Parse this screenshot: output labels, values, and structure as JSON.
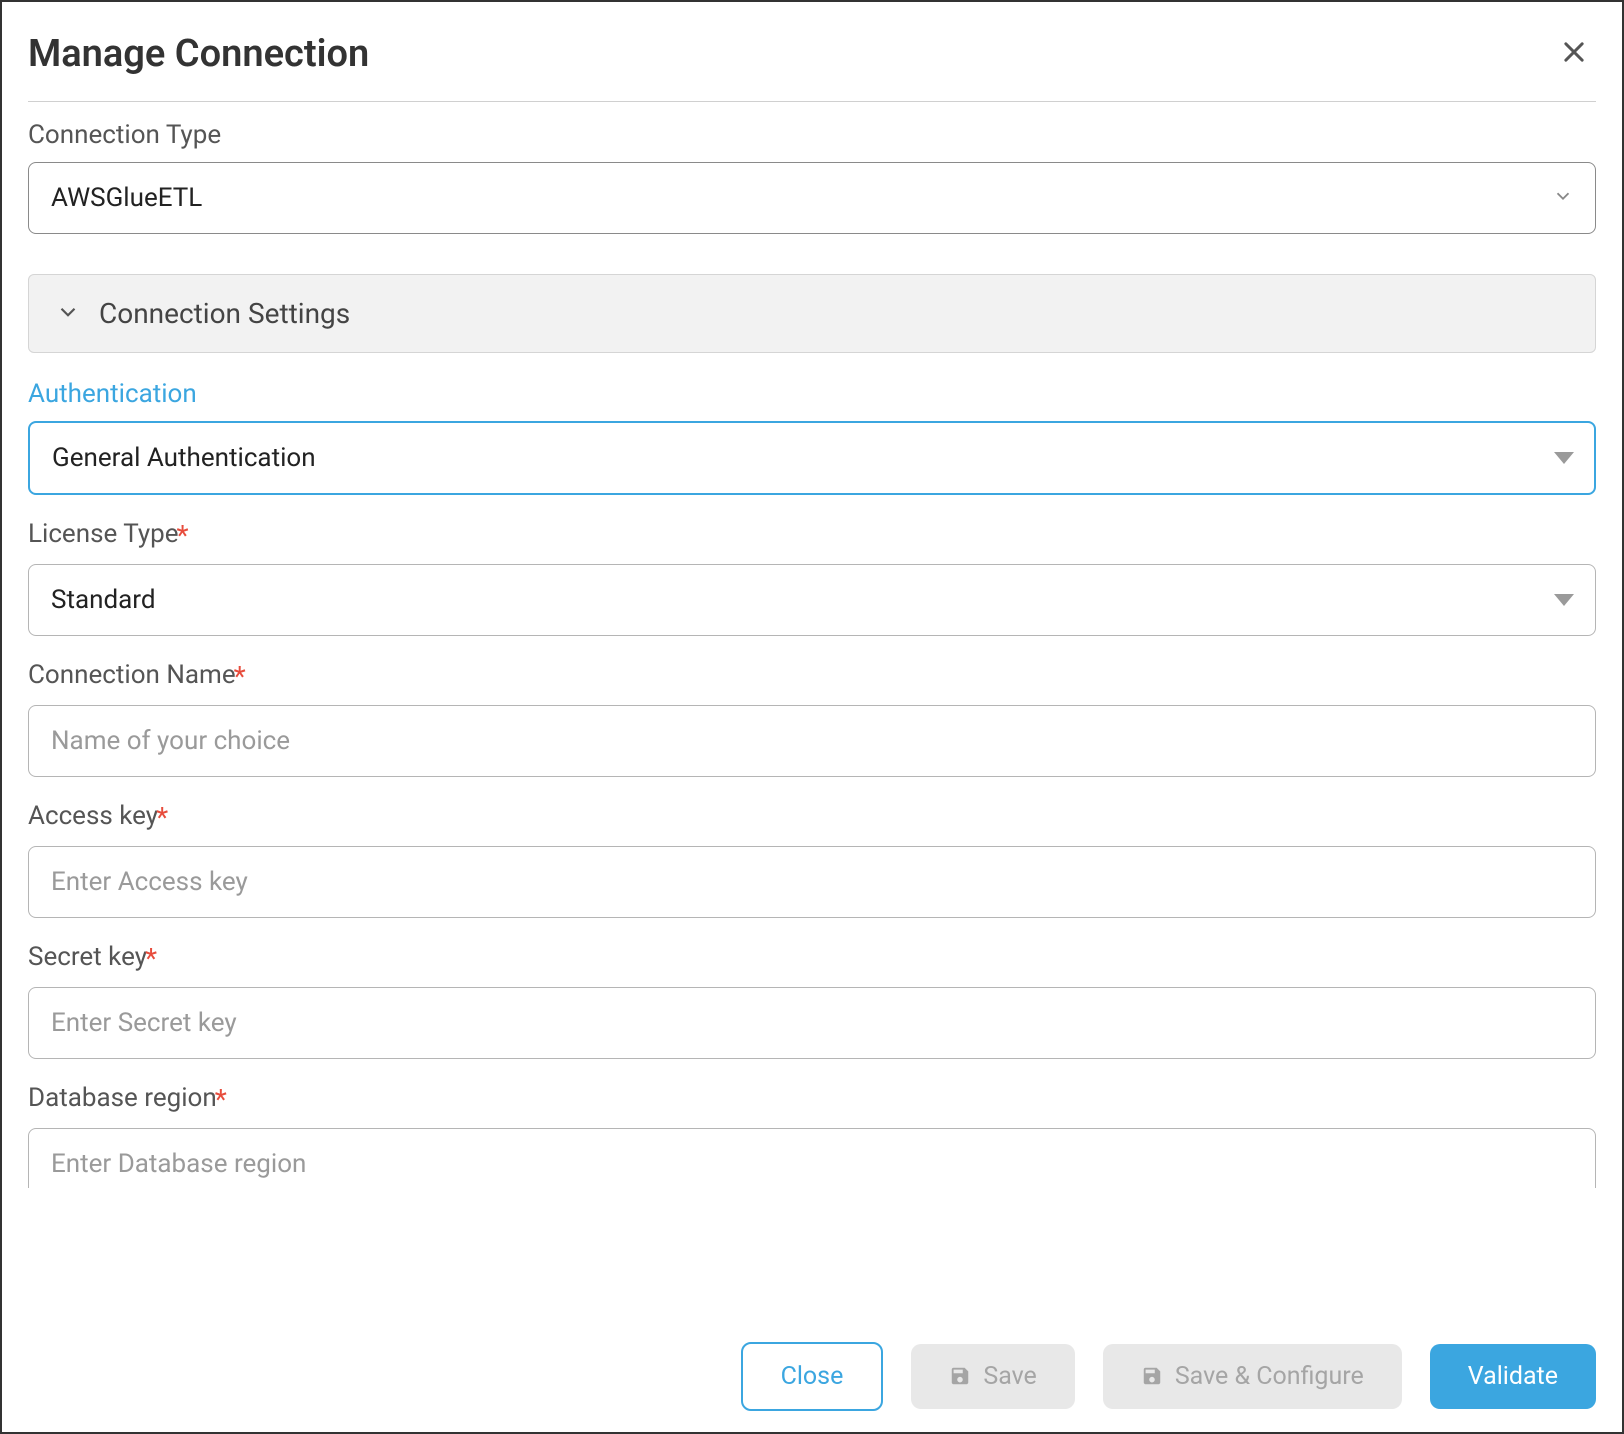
{
  "modal": {
    "title": "Manage Connection"
  },
  "fields": {
    "connectionType": {
      "label": "Connection Type",
      "value": "AWSGlueETL"
    },
    "connectionSettings": {
      "title": "Connection Settings"
    },
    "authentication": {
      "label": "Authentication",
      "value": "General Authentication"
    },
    "licenseType": {
      "label": "License Type",
      "value": "Standard"
    },
    "connectionName": {
      "label": "Connection Name",
      "placeholder": "Name of your choice",
      "value": ""
    },
    "accessKey": {
      "label": "Access key",
      "placeholder": "Enter Access key",
      "value": ""
    },
    "secretKey": {
      "label": "Secret key",
      "placeholder": "Enter Secret key",
      "value": ""
    },
    "databaseRegion": {
      "label": "Database region",
      "placeholder": "Enter Database region",
      "value": ""
    }
  },
  "buttons": {
    "close": "Close",
    "save": "Save",
    "saveConfigure": "Save & Configure",
    "validate": "Validate"
  },
  "required_marker": "*"
}
